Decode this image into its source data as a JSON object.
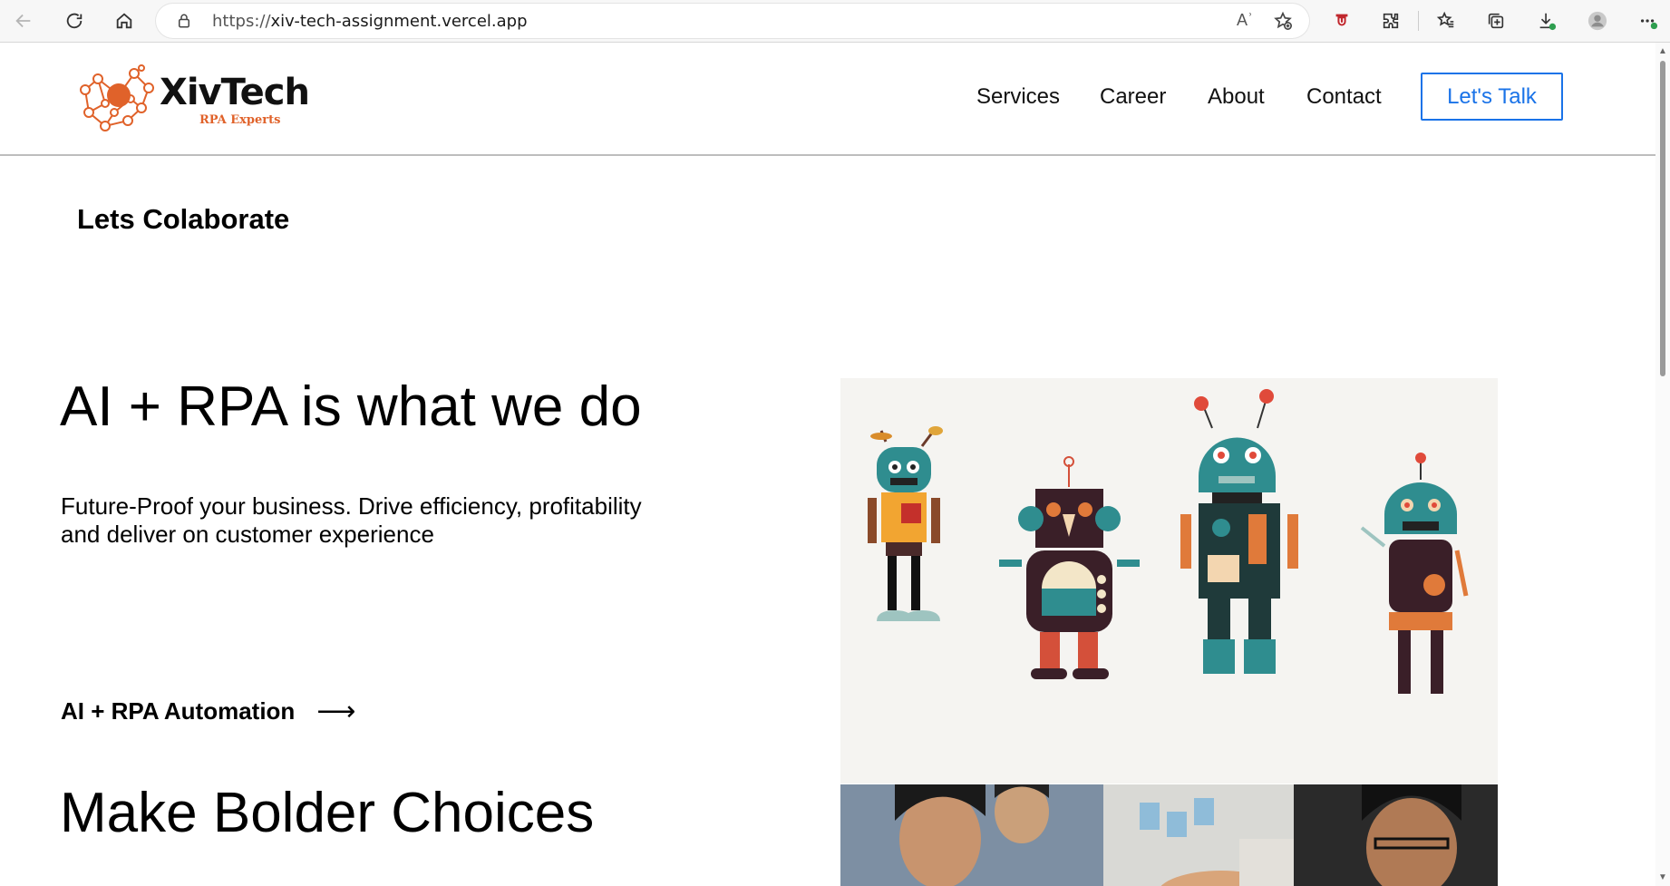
{
  "browser": {
    "url_prefix": "https://",
    "url_host": "xiv-tech-assignment.vercel.app",
    "read_aloud": "Aʾ"
  },
  "site": {
    "logo_name": "XivTech",
    "logo_tagline": "RPA Experts",
    "nav": [
      "Services",
      "Career",
      "About",
      "Contact"
    ],
    "cta": "Let's Talk",
    "collab_heading": "Lets Colaborate",
    "hero_title": "AI + RPA is what we do",
    "hero_subtitle": "Future-Proof your business. Drive efficiency, profitability and deliver on customer experience",
    "section_link": "AI + RPA Automation",
    "section_link_arrow": "⟶",
    "hero2_title": "Make Bolder Choices"
  },
  "colors": {
    "brand_orange": "#e0622a",
    "cta_blue": "#1a73e8"
  }
}
